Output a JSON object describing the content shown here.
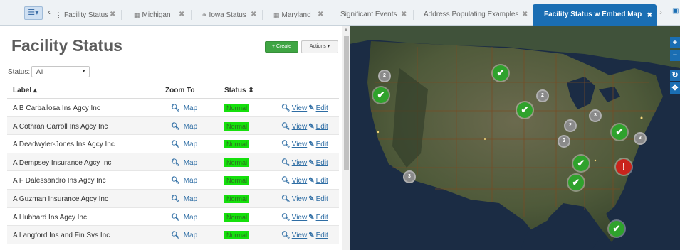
{
  "tabs": [
    {
      "label": "Facility Status",
      "icon": "drag-handle-icon",
      "glyph": "⋮"
    },
    {
      "label": "Michigan",
      "icon": "grid-icon",
      "glyph": "▦"
    },
    {
      "label": "Iowa Status",
      "icon": "binoculars-icon",
      "glyph": "⚭"
    },
    {
      "label": "Maryland",
      "icon": "grid-icon",
      "glyph": "▦"
    },
    {
      "label": "Significant Events",
      "icon": "",
      "glyph": ""
    },
    {
      "label": "Address Populating Examples",
      "icon": "",
      "glyph": ""
    },
    {
      "label": "Facility Status w Embed Map",
      "icon": "",
      "glyph": "",
      "active": true
    }
  ],
  "header": {
    "title": "Facility Status",
    "create_label": "+ Create",
    "actions_label": "Actions ▾"
  },
  "filter": {
    "status_label": "Status:",
    "status_value": "All"
  },
  "grid": {
    "columns": {
      "label": "Label ▴",
      "zoom": "Zoom To",
      "status": "Status ⇕"
    },
    "rows": [
      {
        "label": "A B Carballosa Ins Agcy Inc",
        "zoom": "Map",
        "status": "Normal",
        "view": "View",
        "edit": "Edit"
      },
      {
        "label": "A Cothran Carroll Ins Agcy Inc",
        "zoom": "Map",
        "status": "Normal",
        "view": "View",
        "edit": "Edit"
      },
      {
        "label": "A Deadwyler-Jones Ins Agcy Inc",
        "zoom": "Map",
        "status": "Normal",
        "view": "View",
        "edit": "Edit"
      },
      {
        "label": "A Dempsey Insurance Agcy Inc",
        "zoom": "Map",
        "status": "Normal",
        "view": "View",
        "edit": "Edit"
      },
      {
        "label": "A F Dalessandro Ins Agcy Inc",
        "zoom": "Map",
        "status": "Normal",
        "view": "View",
        "edit": "Edit"
      },
      {
        "label": "A Guzman Insurance Agcy Inc",
        "zoom": "Map",
        "status": "Normal",
        "view": "View",
        "edit": "Edit"
      },
      {
        "label": "A Hubbard Ins Agcy Inc",
        "zoom": "Map",
        "status": "Normal",
        "view": "View",
        "edit": "Edit"
      },
      {
        "label": "A Langford Ins and Fin Svs Inc",
        "zoom": "Map",
        "status": "Normal",
        "view": "View",
        "edit": "Edit"
      }
    ]
  },
  "map": {
    "clusters": [
      "2",
      "2",
      "3",
      "2",
      "2",
      "3",
      "3"
    ],
    "ok_markers": 7,
    "alert_markers": 1,
    "controls": [
      "+",
      "−",
      "↻",
      "✥"
    ]
  },
  "colors": {
    "accent": "#1a6eb3",
    "create": "#3fa543",
    "status_normal": "#15e00c",
    "alert": "#c9231c"
  }
}
